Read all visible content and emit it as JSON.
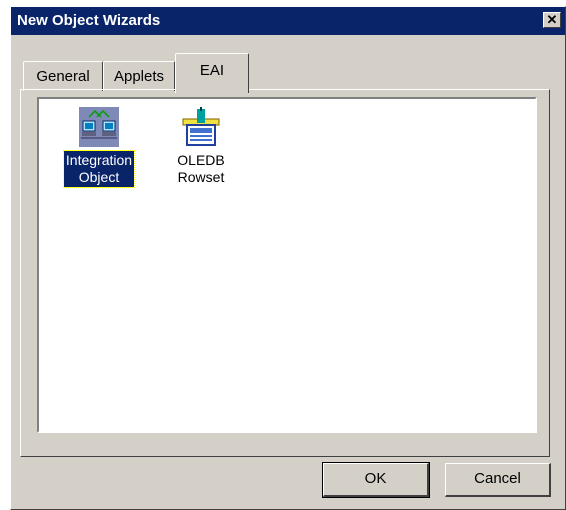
{
  "window": {
    "title": "New Object Wizards",
    "close_glyph": "✕"
  },
  "tabs": [
    {
      "label": "General",
      "active": false
    },
    {
      "label": "Applets",
      "active": false
    },
    {
      "label": "EAI",
      "active": true
    }
  ],
  "items": [
    {
      "line1": "Integration",
      "line2": "Object",
      "icon": "integration-object-icon",
      "selected": true
    },
    {
      "line1": "OLEDB",
      "line2": "Rowset",
      "icon": "oledb-rowset-icon",
      "selected": false
    }
  ],
  "buttons": {
    "ok_label": "OK",
    "cancel_label": "Cancel"
  },
  "colors": {
    "titlebar": "#0a246a",
    "face": "#d4d0c8",
    "selection": "#0a246a"
  }
}
